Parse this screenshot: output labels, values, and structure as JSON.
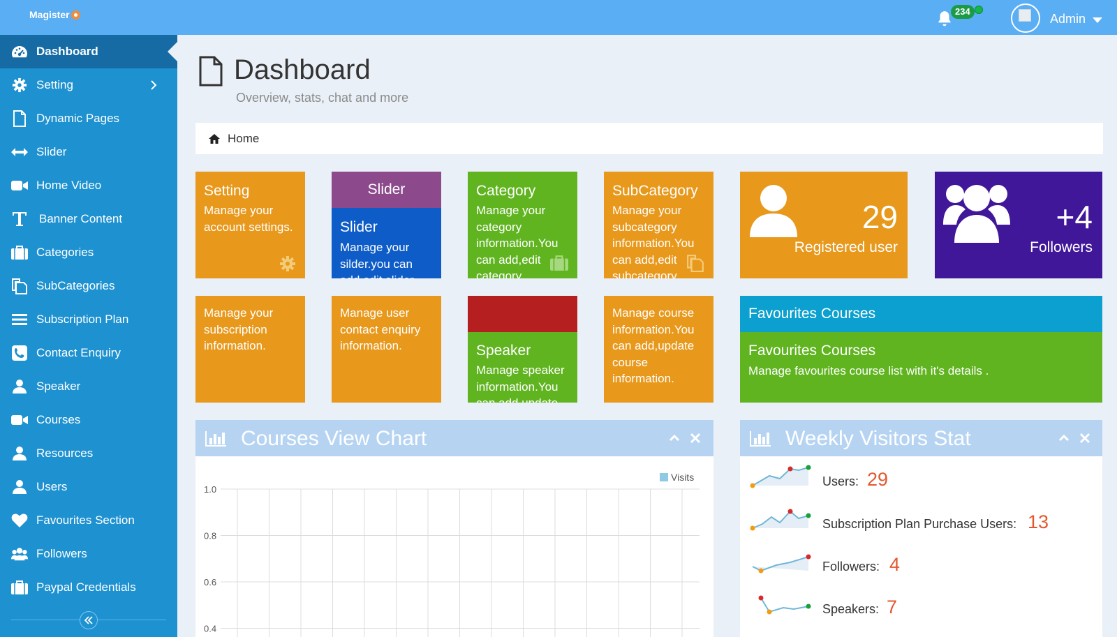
{
  "app": {
    "logo_text": "Magister"
  },
  "header": {
    "notification_count": "234",
    "user_name": "Admin"
  },
  "sidebar": {
    "items": [
      {
        "label": "Dashboard",
        "icon": "dashboard-icon",
        "active": true
      },
      {
        "label": "Setting",
        "icon": "gear-icon"
      },
      {
        "label": "Dynamic Pages",
        "icon": "file-icon"
      },
      {
        "label": "Slider",
        "icon": "arrows-horizontal-icon"
      },
      {
        "label": "Home Video",
        "icon": "video-camera-icon"
      },
      {
        "label": "Banner Content",
        "icon": "text-icon"
      },
      {
        "label": "Categories",
        "icon": "briefcase-icon"
      },
      {
        "label": "SubCategories",
        "icon": "copy-icon"
      },
      {
        "label": "Subscription Plan",
        "icon": "list-icon"
      },
      {
        "label": "Contact Enquiry",
        "icon": "phone-icon"
      },
      {
        "label": "Speaker",
        "icon": "user-icon"
      },
      {
        "label": "Courses",
        "icon": "video-camera-icon"
      },
      {
        "label": "Resources",
        "icon": "user-icon"
      },
      {
        "label": "Users",
        "icon": "user-icon"
      },
      {
        "label": "Favourites Section",
        "icon": "heart-icon"
      },
      {
        "label": "Followers",
        "icon": "users-icon"
      },
      {
        "label": "Paypal Credentials",
        "icon": "briefcase-icon"
      }
    ]
  },
  "page": {
    "title": "Dashboard",
    "subtitle": "Overview, stats, chat and more",
    "breadcrumb": "Home"
  },
  "tiles": {
    "setting": {
      "title": "Setting",
      "desc": "Manage your account settings."
    },
    "slider": {
      "band_title": "Slider",
      "title": "Slider",
      "desc": "Manage your silder.you can add,edit slider."
    },
    "category": {
      "title": "Category",
      "desc": "Manage your category information.You can add,edit category."
    },
    "subcategory": {
      "title": "SubCategory",
      "desc": "Manage your subcategory information.You can add,edit subcategory."
    },
    "registered": {
      "value": "29",
      "label": "Registered user"
    },
    "followers": {
      "value": "+4",
      "label": "Followers"
    },
    "subscription": {
      "desc": "Manage your subscription information."
    },
    "contact": {
      "desc": "Manage user contact enquiry information."
    },
    "speaker": {
      "title": "Speaker",
      "desc": "Manage speaker information.You can add,update speaker."
    },
    "course": {
      "desc": "Manage course information.You can add,update course information."
    },
    "favourites": {
      "band_title": "Favourites Courses",
      "title": "Favourites Courses",
      "desc": "Manage favourites course list with it's details ."
    }
  },
  "colors": {
    "orange": "#e8981b",
    "purple": "#8c4a8c",
    "blue": "#0e5cc7",
    "green": "#60b420",
    "red": "#b51f1f",
    "indigo": "#41179a",
    "teal": "#0ba0cf"
  },
  "courses_chart": {
    "title": "Courses View Chart",
    "chart_data": {
      "type": "line",
      "series": [
        {
          "name": "Visits",
          "values": []
        }
      ],
      "y_ticks": [
        "1.0",
        "0.8",
        "0.6",
        "0.4"
      ],
      "ylim": [
        0.4,
        1.0
      ],
      "grid": true,
      "legend": "top-right"
    }
  },
  "weekly_visitors": {
    "title": "Weekly Visitors Stat",
    "rows": [
      {
        "label": "Users:",
        "value": "29"
      },
      {
        "label": "Subscription Plan Purchase Users:",
        "value": "13"
      },
      {
        "label": "Followers:",
        "value": "4"
      },
      {
        "label": "Speakers:",
        "value": "7"
      }
    ]
  }
}
